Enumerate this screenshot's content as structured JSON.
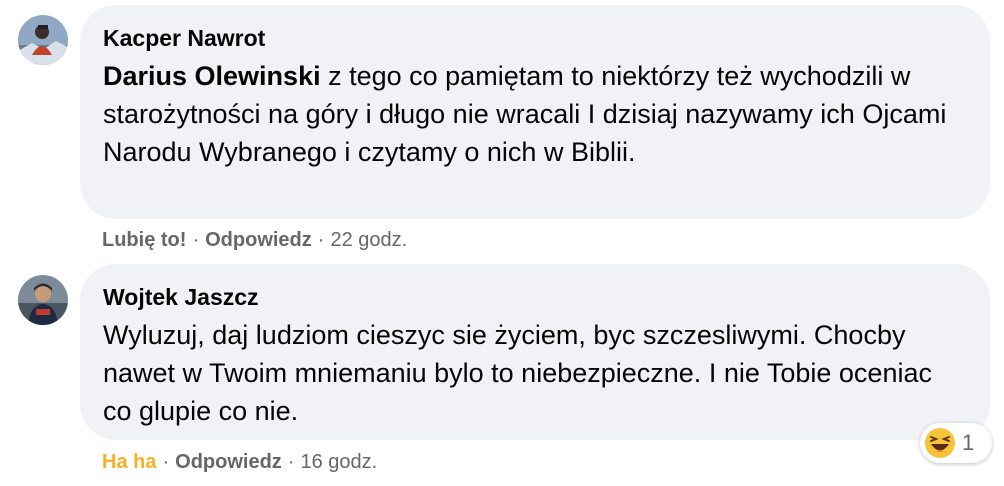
{
  "comments": [
    {
      "author": "Kacper Nawrot",
      "mention": "Darius Olewinski",
      "text": " z tego co pamiętam to niektórzy też wychodzili w starożytności na góry i długo nie wracali I dzisiaj nazywamy ich Ojcami Narodu Wybranego i czytamy o nich w Biblii.",
      "like_label": "Lubię to!",
      "reply_label": "Odpowiedz",
      "time": "22 godz."
    },
    {
      "author": "Wojtek Jaszcz",
      "text": "Wyluzuj, daj ludziom cieszyc sie życiem, byc szczesliwymi. Chocby nawet w Twoim mniemaniu bylo to niebezpieczne. I nie Tobie oceniac co glupie co nie.",
      "like_label": "Ha ha",
      "reply_label": "Odpowiedz",
      "time": "16 godz.",
      "reaction": {
        "icon": "haha-emoji-icon",
        "count": "1"
      }
    }
  ],
  "separator": "·",
  "colors": {
    "bubble": "#f0f2f5",
    "meta": "#65676b",
    "haha": "#f7b125"
  }
}
